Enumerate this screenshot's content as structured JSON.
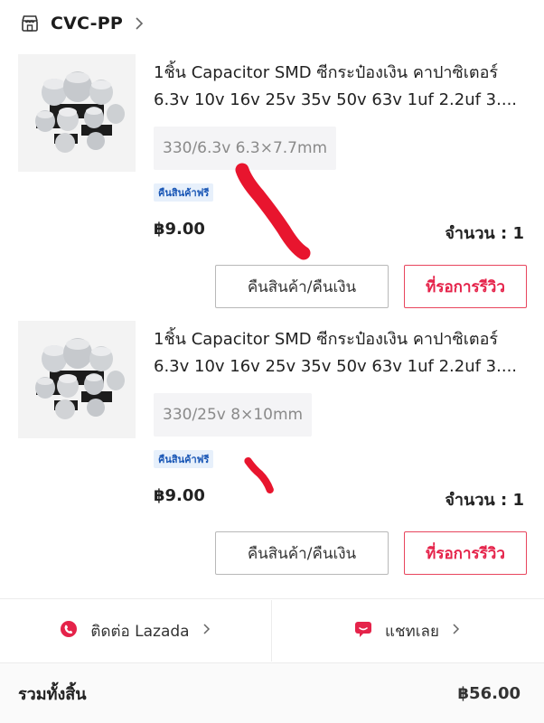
{
  "shop": {
    "icon": "store-icon",
    "name": "CVC-PP",
    "chevron": "chevron-right-icon"
  },
  "items": [
    {
      "image_icon": "capacitor-product-image",
      "title_line1": "1ชิ้น Capacitor SMD ซีกระป๋องเงิน คาปาซิเตอร์",
      "title_line2": "6.3v 10v 16v 25v 35v 50v 63v 1uf 2.2uf 3....",
      "variant": "330/6.3v 6.3×7.7mm",
      "badge": "คืนสินค้าฟรี",
      "price": "฿9.00",
      "qty": "จำนวน : 1",
      "return_label": "คืนสินค้า/คืนเงิน",
      "review_label": "ที่รอการรีวิว"
    },
    {
      "image_icon": "capacitor-product-image",
      "title_line1": "1ชิ้น Capacitor SMD ซีกระป๋องเงิน คาปาซิเตอร์",
      "title_line2": "6.3v 10v 16v 25v 35v 50v 63v 1uf 2.2uf 3....",
      "variant": "330/25v 8×10mm",
      "badge": "คืนสินค้าฟรี",
      "price": "฿9.00",
      "qty": "จำนวน : 1",
      "return_label": "คืนสินค้า/คืนเงิน",
      "review_label": "ที่รอการรีวิว"
    }
  ],
  "footer": {
    "contact_label": "ติดต่อ Lazada",
    "contact_icon": "lazada-support-icon",
    "chat_label": "แชทเลย",
    "chat_icon": "chat-icon"
  },
  "total": {
    "label": "รวมทั้งสิ้น",
    "value": "฿56.00"
  },
  "colors": {
    "accent": "#e5234a",
    "scribble": "#e8152e",
    "badge_text": "#1a57b6",
    "badge_bg": "#e7f0fb"
  }
}
